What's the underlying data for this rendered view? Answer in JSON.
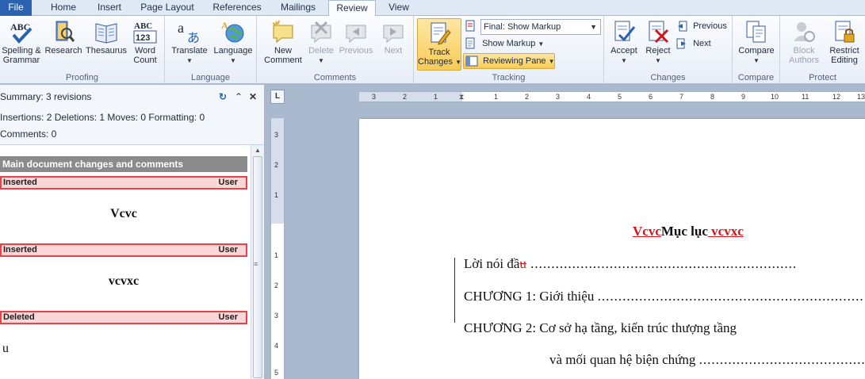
{
  "tabs": [
    {
      "label": "File",
      "state": "file"
    },
    {
      "label": "Home",
      "state": ""
    },
    {
      "label": "Insert",
      "state": ""
    },
    {
      "label": "Page Layout",
      "state": ""
    },
    {
      "label": "References",
      "state": ""
    },
    {
      "label": "Mailings",
      "state": ""
    },
    {
      "label": "Review",
      "state": "active"
    },
    {
      "label": "View",
      "state": ""
    }
  ],
  "ribbon": {
    "proofing": {
      "label": "Proofing",
      "spelling": "Spelling &",
      "spelling2": "Grammar",
      "research": "Research",
      "thesaurus": "Thesaurus",
      "wordcount": "Word",
      "wordcount2": "Count"
    },
    "language": {
      "label": "Language",
      "translate": "Translate",
      "language": "Language"
    },
    "comments": {
      "label": "Comments",
      "new": "New",
      "new2": "Comment",
      "delete": "Delete",
      "previous": "Previous",
      "next": "Next"
    },
    "tracking": {
      "label": "Tracking",
      "track": "Track",
      "track2": "Changes",
      "display_value": "Final: Show Markup",
      "show_markup": "Show Markup",
      "reviewing_pane": "Reviewing Pane"
    },
    "changes": {
      "label": "Changes",
      "accept": "Accept",
      "reject": "Reject",
      "previous": "Previous",
      "next": "Next"
    },
    "compare": {
      "label": "Compare",
      "compare": "Compare"
    },
    "protect": {
      "label": "Protect",
      "block": "Block",
      "block2": "Authors",
      "restrict": "Restrict",
      "restrict2": "Editing"
    }
  },
  "pane": {
    "summary": "Summary: 3 revisions",
    "counts": "Insertions: 2  Deletions: 1  Moves: 0  Formatting: 0",
    "comments": "Comments: 0",
    "section_title": "Main document changes and comments",
    "revisions": [
      {
        "type": "Inserted",
        "user": "User",
        "text": "Vcvc"
      },
      {
        "type": "Inserted",
        "user": "User",
        "text": "vcvxc"
      },
      {
        "type": "Deleted",
        "user": "User",
        "text": "u"
      }
    ]
  },
  "ruler": {
    "h_ticks": [
      "3",
      "2",
      "1",
      "1",
      "2",
      "3",
      "4",
      "5",
      "6",
      "7",
      "8",
      "9",
      "10",
      "11",
      "12",
      "13"
    ],
    "v_ticks": [
      "3",
      "2",
      "1",
      "1",
      "2",
      "3",
      "4",
      "5"
    ],
    "corner": "L"
  },
  "document": {
    "title_ins1": "Vcvc",
    "title_main": "Mục lục",
    "title_ins2": " vcvxc",
    "line1_text": "Lời nói đầ",
    "line1_del": "u",
    "line1_dots": "  ................................................................",
    "line2_text": "CHƯƠNG 1: Giới thiệu ",
    "line2_dots": "................................................................",
    "line3_text": "CHƯƠNG 2: Cơ sở hạ tầng, kiến trúc thượng tầng",
    "line4_text": "và mối quan hệ biện chứng ",
    "line4_dots": "....................................................."
  }
}
